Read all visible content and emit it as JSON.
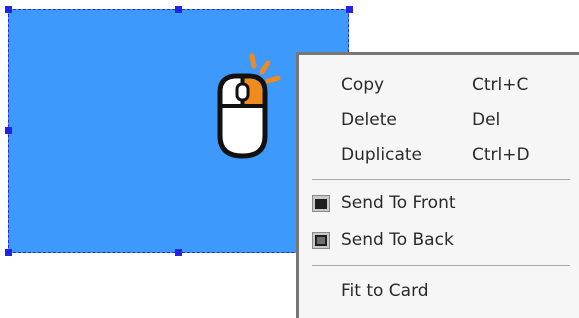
{
  "menu": {
    "items": [
      {
        "label": "Copy",
        "shortcut": "Ctrl+C"
      },
      {
        "label": "Delete",
        "shortcut": "Del"
      },
      {
        "label": "Duplicate",
        "shortcut": "Ctrl+D"
      },
      {
        "label": "Send To Front",
        "icon": "send-to-front-icon"
      },
      {
        "label": "Send To Back",
        "icon": "send-to-back-icon"
      },
      {
        "label": "Fit to Card"
      }
    ]
  },
  "shape": {
    "fill_color": "#3d99fc",
    "selected": true
  },
  "icons": {
    "cursor": "mouse-click-icon"
  },
  "colors": {
    "selection_handle": "#2424e0",
    "menu_background": "#f6f6f6",
    "menu_border": "#767676",
    "click_accent": "#f08a1e"
  }
}
